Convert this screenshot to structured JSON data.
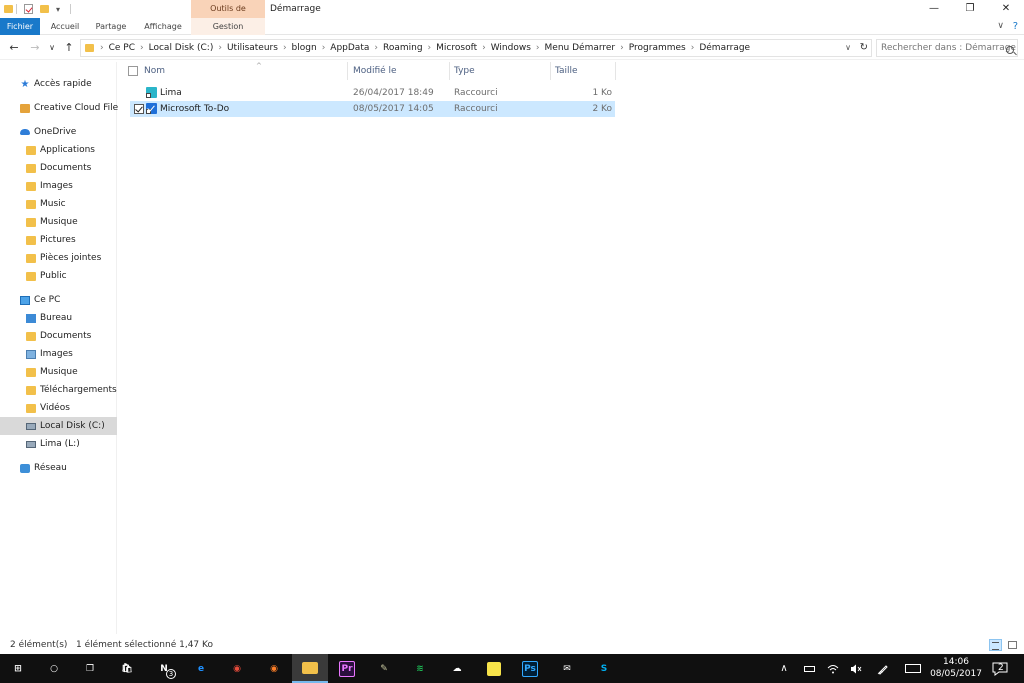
{
  "titlebar": {
    "context_tab": "Outils de raccourci",
    "title": "Démarrage",
    "minimize": "—",
    "restore": "❐",
    "close": "✕"
  },
  "ribbon": {
    "tabs": [
      "Fichier",
      "Accueil",
      "Partage",
      "Affichage",
      "Gestion"
    ],
    "caret": "∨",
    "help": "?"
  },
  "addressbar": {
    "back": "←",
    "forward": "→",
    "recent": "∨",
    "up": "↑",
    "crumbs": [
      "Ce PC",
      "Local Disk (C:)",
      "Utilisateurs",
      "blogn",
      "AppData",
      "Roaming",
      "Microsoft",
      "Windows",
      "Menu Démarrer",
      "Programmes",
      "Démarrage"
    ],
    "crumb_separator": "›",
    "lead_separator": "›",
    "dropdown": "∨",
    "refresh": "↻",
    "search_placeholder": "Rechercher dans : Démarrage"
  },
  "navpane": {
    "items": [
      {
        "label": "Accès rapide",
        "icon": "star-icon"
      },
      {
        "label": "Creative Cloud Files",
        "icon": "creative-cloud-icon"
      },
      {
        "label": "OneDrive",
        "icon": "onedrive-icon"
      },
      {
        "label": "Applications",
        "icon": "folder-icon"
      },
      {
        "label": "Documents",
        "icon": "folder-icon"
      },
      {
        "label": "Images",
        "icon": "folder-icon"
      },
      {
        "label": "Music",
        "icon": "folder-icon"
      },
      {
        "label": "Musique",
        "icon": "folder-icon"
      },
      {
        "label": "Pictures",
        "icon": "folder-icon"
      },
      {
        "label": "Pièces jointes",
        "icon": "folder-icon"
      },
      {
        "label": "Public",
        "icon": "folder-icon"
      },
      {
        "label": "Ce PC",
        "icon": "pc-icon"
      },
      {
        "label": "Bureau",
        "icon": "desktop-folder-icon"
      },
      {
        "label": "Documents",
        "icon": "documents-folder-icon"
      },
      {
        "label": "Images",
        "icon": "images-folder-icon"
      },
      {
        "label": "Musique",
        "icon": "music-folder-icon"
      },
      {
        "label": "Téléchargements",
        "icon": "downloads-folder-icon"
      },
      {
        "label": "Vidéos",
        "icon": "videos-folder-icon"
      },
      {
        "label": "Local Disk (C:)",
        "icon": "drive-icon"
      },
      {
        "label": "Lima (L:)",
        "icon": "drive-icon"
      },
      {
        "label": "Réseau",
        "icon": "network-icon"
      }
    ]
  },
  "filelist": {
    "columns": {
      "name": "Nom",
      "modified": "Modifié le",
      "type": "Type",
      "size": "Taille"
    },
    "sort_indicator": "^",
    "rows": [
      {
        "name": "Lima",
        "modified": "26/04/2017 18:49",
        "type": "Raccourci",
        "size": "1 Ko",
        "icon": "lima-shortcut-icon",
        "selected": false
      },
      {
        "name": "Microsoft To-Do",
        "modified": "08/05/2017 14:05",
        "type": "Raccourci",
        "size": "2 Ko",
        "icon": "todo-shortcut-icon",
        "selected": true
      }
    ]
  },
  "statusbar": {
    "count": "2 élément(s)",
    "selection": "1 élément sélectionné  1,47 Ko"
  },
  "taskbar": {
    "apps": [
      {
        "name": "start-button",
        "glyph": "⊞",
        "color": "#ffffff"
      },
      {
        "name": "cortana-button",
        "glyph": "○",
        "color": "#ffffff"
      },
      {
        "name": "task-view-button",
        "glyph": "❐",
        "color": "#ffffff"
      },
      {
        "name": "store-app",
        "glyph": "🛍",
        "color": "#ffffff"
      },
      {
        "name": "onenote-app",
        "glyph": "N",
        "color": "#ffffff"
      },
      {
        "name": "edge-app",
        "glyph": "e",
        "color": "#1e90ff"
      },
      {
        "name": "chrome-app",
        "glyph": "◉",
        "color": "#e74c3c"
      },
      {
        "name": "firefox-app",
        "glyph": "◉",
        "color": "#ff7f27"
      },
      {
        "name": "file-explorer-app",
        "glyph": "▭",
        "color": "#f2c04a"
      },
      {
        "name": "premiere-app",
        "glyph": "Pr",
        "color": "#ea77ff"
      },
      {
        "name": "brush-app",
        "glyph": "✎",
        "color": "#c9c9a0"
      },
      {
        "name": "spotify-app",
        "glyph": "≋",
        "color": "#1db954"
      },
      {
        "name": "cloud-app",
        "glyph": "☁",
        "color": "#ffffff"
      },
      {
        "name": "sticky-notes-app",
        "glyph": "▢",
        "color": "#f7e34a"
      },
      {
        "name": "photoshop-app",
        "glyph": "Ps",
        "color": "#31a8ff"
      },
      {
        "name": "mail-app",
        "glyph": "✉",
        "color": "#ffffff"
      },
      {
        "name": "skype-app",
        "glyph": "S",
        "color": "#00aff0"
      }
    ],
    "onenote_badge": "3",
    "tray_chevron": "∧",
    "clock_time": "14:06",
    "clock_date": "08/05/2017",
    "notification_count": "2"
  }
}
